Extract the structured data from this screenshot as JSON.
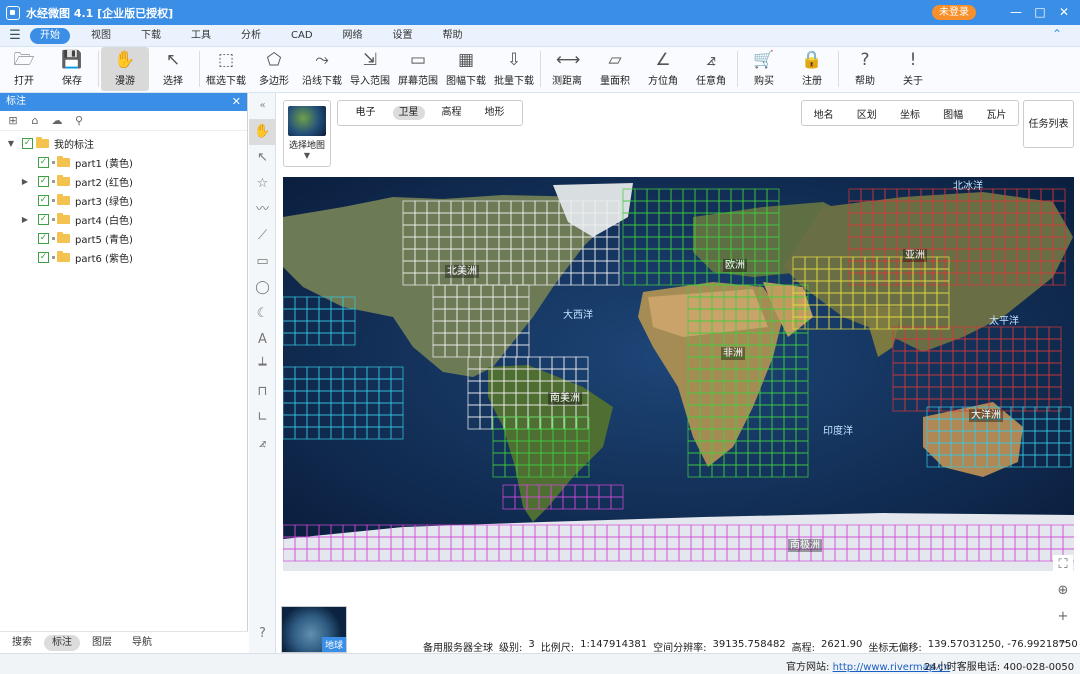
{
  "window": {
    "title": "水经微图 4.1 [企业版已授权]",
    "login": "未登录",
    "minimize": "—",
    "maximize": "□",
    "close": "✕"
  },
  "menu": {
    "items": [
      "开始",
      "视图",
      "下载",
      "工具",
      "分析",
      "CAD",
      "网络",
      "设置",
      "帮助"
    ],
    "active": "开始"
  },
  "toolbar": {
    "items": [
      {
        "label": "打开",
        "icon": "folder-open-icon",
        "glyph": "🗁"
      },
      {
        "label": "保存",
        "icon": "save-icon",
        "glyph": "💾"
      },
      {
        "label": "漫游",
        "icon": "hand-icon",
        "glyph": "✋"
      },
      {
        "label": "选择",
        "icon": "cursor-icon",
        "glyph": "↖"
      },
      {
        "label": "框选下载",
        "icon": "box-download-icon",
        "glyph": "⬚"
      },
      {
        "label": "多边形",
        "icon": "polygon-download-icon",
        "glyph": "⬠"
      },
      {
        "label": "沿线下载",
        "icon": "line-download-icon",
        "glyph": "⤳"
      },
      {
        "label": "导入范围",
        "icon": "import-range-icon",
        "glyph": "⇲"
      },
      {
        "label": "屏幕范围",
        "icon": "screen-range-icon",
        "glyph": "▭"
      },
      {
        "label": "图幅下载",
        "icon": "sheet-download-icon",
        "glyph": "▦"
      },
      {
        "label": "批量下载",
        "icon": "batch-download-icon",
        "glyph": "⇩"
      },
      {
        "label": "测距离",
        "icon": "measure-distance-icon",
        "glyph": "⟷"
      },
      {
        "label": "量面积",
        "icon": "measure-area-icon",
        "glyph": "▱"
      },
      {
        "label": "方位角",
        "icon": "azimuth-icon",
        "glyph": "∠"
      },
      {
        "label": "任意角",
        "icon": "any-angle-icon",
        "glyph": "⦨"
      },
      {
        "label": "购买",
        "icon": "cart-icon",
        "glyph": "🛒"
      },
      {
        "label": "注册",
        "icon": "lock-icon",
        "glyph": "🔒"
      },
      {
        "label": "帮助",
        "icon": "help-icon",
        "glyph": "?"
      },
      {
        "label": "关于",
        "icon": "info-icon",
        "glyph": "!"
      }
    ],
    "active": "漫游"
  },
  "panel": {
    "title": "标注",
    "tools": [
      "add-icon",
      "folder-icon",
      "cloud-icon",
      "search-icon"
    ],
    "root": "我的标注",
    "items": [
      {
        "label": "part1 (黄色)",
        "expandable": false
      },
      {
        "label": "part2 (红色)",
        "expandable": true
      },
      {
        "label": "part3 (绿色)",
        "expandable": false
      },
      {
        "label": "part4 (白色)",
        "expandable": true
      },
      {
        "label": "part5 (青色)",
        "expandable": false
      },
      {
        "label": "part6 (紫色)",
        "expandable": false
      }
    ],
    "tabs": [
      "搜索",
      "标注",
      "图层",
      "导航"
    ],
    "active_tab": "标注"
  },
  "side_tools": [
    "hand-icon",
    "pointer-icon",
    "star-icon",
    "line-icon",
    "area-icon",
    "rect-icon",
    "circle-icon",
    "moon-icon",
    "text-icon",
    "ruler-icon",
    "area-measure-icon",
    "angle-icon",
    "any-angle-icon"
  ],
  "map_controls": {
    "select_map": "选择地图",
    "types": [
      "电子",
      "卫星",
      "高程",
      "地形"
    ],
    "active_type": "卫星",
    "overlays": [
      "地名",
      "区划",
      "坐标",
      "图幅",
      "瓦片"
    ],
    "task_list": "任务列表",
    "globe": "地球"
  },
  "map_labels": {
    "continents": [
      "北美洲",
      "欧洲",
      "亚洲",
      "非洲",
      "南美洲",
      "大洋洲",
      "南极洲"
    ],
    "oceans": [
      "北冰洋",
      "大西洋",
      "太平洋",
      "印度洋"
    ]
  },
  "grid_colors": {
    "part1": "#e8e040",
    "part2": "#d23a3a",
    "part3": "#3fcf3f",
    "part4": "#f2f2f2",
    "part5": "#35c8e0",
    "part6": "#d04ad8"
  },
  "status": {
    "server": "备用服务器全球",
    "level_label": "级别:",
    "level": "3",
    "scale_label": "比例尺:",
    "scale": "1:147914381",
    "resolution_label": "空间分辨率:",
    "resolution": "39135.758482",
    "elevation_label": "高程:",
    "elevation": "2621.90",
    "coord_label": "坐标无偏移:",
    "coord": "139.57031250, -76.99218750"
  },
  "footer": {
    "site_label": "官方网站:",
    "site_url": "http://www.rivermap.cn",
    "phone_label": "24小时客服电话:",
    "phone": "400-028-0050"
  }
}
